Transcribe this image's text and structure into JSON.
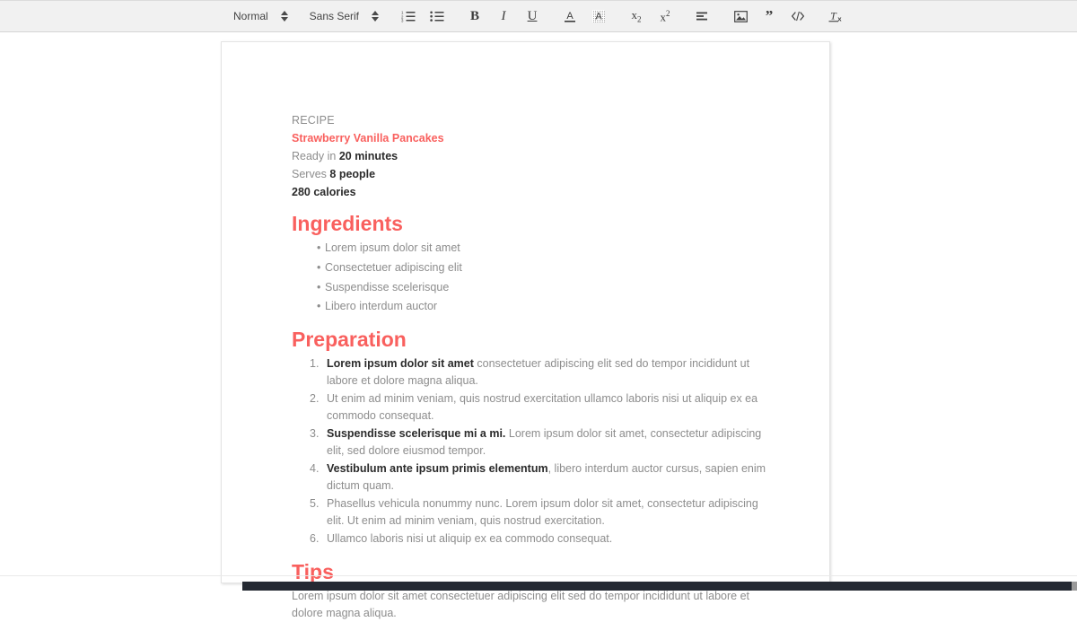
{
  "toolbar": {
    "block_format": {
      "label": "Normal",
      "icon": "chevron-updown-icon"
    },
    "font_family": {
      "label": "Sans Serif",
      "icon": "chevron-updown-icon"
    },
    "buttons": [
      {
        "name": "ordered-list-button",
        "icon": "ordered-list-icon",
        "label": "Ordered List"
      },
      {
        "name": "bullet-list-button",
        "icon": "bullet-list-icon",
        "label": "Bullet List"
      },
      {
        "name": "bold-button",
        "icon": "bold-icon",
        "label": "B"
      },
      {
        "name": "italic-button",
        "icon": "italic-icon",
        "label": "I"
      },
      {
        "name": "underline-button",
        "icon": "underline-icon",
        "label": "U"
      },
      {
        "name": "text-color-button",
        "icon": "text-color-icon",
        "label": "A"
      },
      {
        "name": "highlight-color-button",
        "icon": "highlight-color-icon",
        "label": "A"
      },
      {
        "name": "subscript-button",
        "icon": "subscript-icon",
        "label": "x2"
      },
      {
        "name": "superscript-button",
        "icon": "superscript-icon",
        "label": "x2"
      },
      {
        "name": "align-button",
        "icon": "align-left-icon",
        "label": "Align"
      },
      {
        "name": "insert-image-button",
        "icon": "image-icon",
        "label": "Image"
      },
      {
        "name": "blockquote-button",
        "icon": "quote-icon",
        "label": "Quote"
      },
      {
        "name": "code-block-button",
        "icon": "code-icon",
        "label": "Code"
      },
      {
        "name": "clear-formatting-button",
        "icon": "clear-format-icon",
        "label": "Tx"
      }
    ]
  },
  "document": {
    "kicker": "RECIPE",
    "title": "Strawberry Vanilla Pancakes",
    "ready_label": "Ready in ",
    "ready_value": "20 minutes",
    "serves_label": "Serves ",
    "serves_value": "8 people",
    "calories": "280 calories",
    "ingredients_heading": "Ingredients",
    "ingredients": [
      "Lorem ipsum dolor sit amet",
      "Consectetuer adipiscing elit",
      "Suspendisse scelerisque",
      "Libero interdum auctor"
    ],
    "preparation_heading": "Preparation",
    "steps": [
      {
        "bold": "Lorem ipsum dolor sit amet",
        "rest": " consectetuer adipiscing elit sed do tempor incididunt ut labore et dolore magna aliqua."
      },
      {
        "bold": "",
        "rest": "Ut enim ad minim veniam, quis nostrud exercitation ullamco laboris nisi ut aliquip ex ea commodo consequat."
      },
      {
        "bold": "Suspendisse scelerisque mi a mi.",
        "rest": " Lorem ipsum dolor sit amet, consectetur adipiscing elit, sed dolore eiusmod tempor."
      },
      {
        "bold": "Vestibulum ante ipsum primis elementum",
        "rest": ", libero interdum auctor cursus, sapien enim dictum quam."
      },
      {
        "bold": "",
        "rest": "Phasellus vehicula nonummy nunc. Lorem ipsum dolor sit amet, consectetur adipiscing elit. Ut enim ad minim veniam, quis nostrud exercitation."
      },
      {
        "bold": "",
        "rest": "Ullamco laboris nisi ut aliquip ex ea commodo consequat."
      }
    ],
    "tips_heading": "Tips",
    "tips_text": "Lorem ipsum dolor sit amet consectetuer adipiscing elit sed do tempor incididunt ut labore et dolore magna aliqua."
  },
  "colors": {
    "accent": "#f9605e",
    "body_text": "#8d8d8d",
    "strong_text": "#2b2b2b",
    "toolbar_bg": "#f1f1f1",
    "bottom_bar": "#252a33"
  }
}
